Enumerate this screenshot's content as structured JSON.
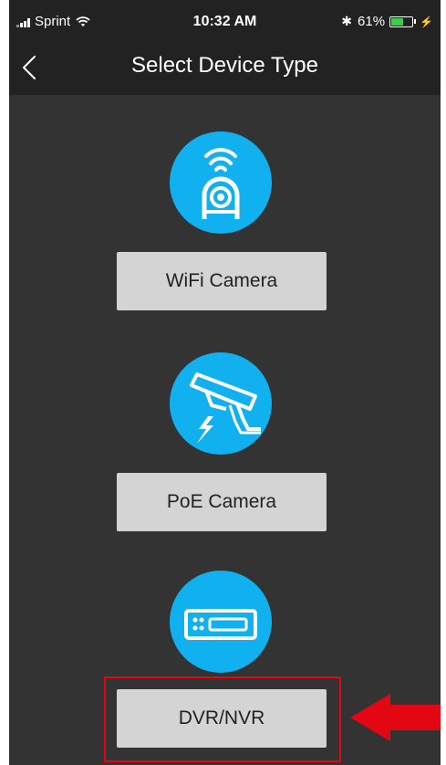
{
  "status_bar": {
    "carrier": "Sprint",
    "time": "10:32 AM",
    "battery_percent": "61%",
    "battery_level": 0.61,
    "signal_icon": "signal-bars-icon",
    "wifi_icon": "wifi-icon",
    "bluetooth_icon": "bluetooth-icon",
    "charging_icon": "charging-bolt-icon"
  },
  "nav": {
    "title": "Select Device Type",
    "back_icon": "chevron-left-icon"
  },
  "devices": [
    {
      "label": "WiFi Camera",
      "icon": "wifi-camera-icon"
    },
    {
      "label": "PoE Camera",
      "icon": "security-camera-icon"
    },
    {
      "label": "DVR/NVR",
      "icon": "dvr-recorder-icon"
    }
  ],
  "colors": {
    "accent": "#11b1ef",
    "background": "#333333",
    "bar_background": "#222222",
    "button": "#d4d4d4",
    "highlight": "#e30613"
  }
}
